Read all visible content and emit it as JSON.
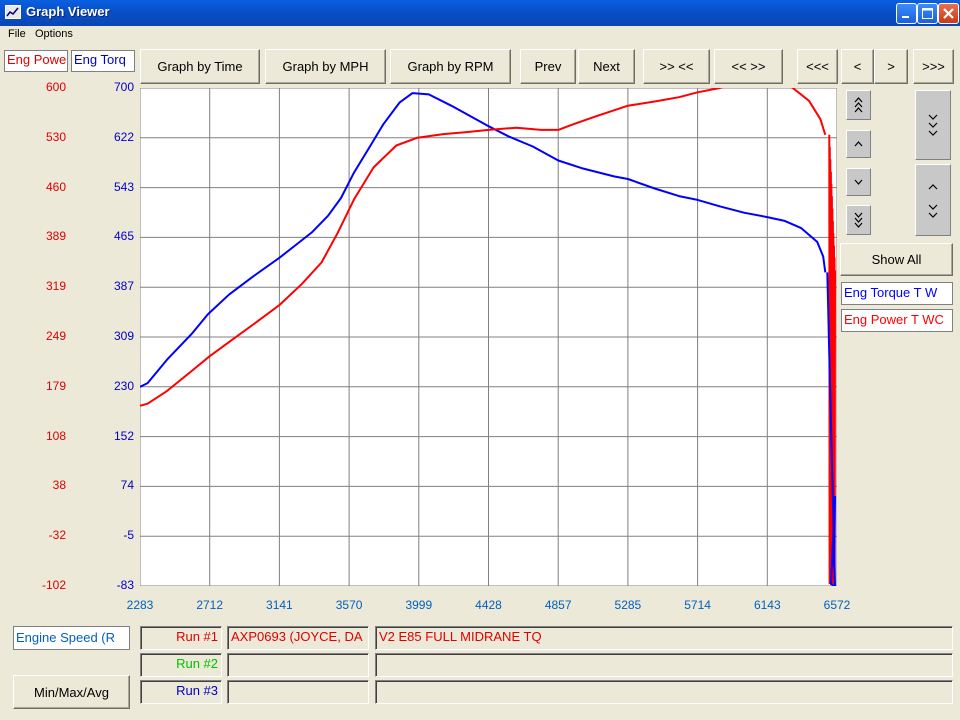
{
  "window": {
    "title": "Graph Viewer"
  },
  "menu": {
    "items": [
      "File",
      "Options"
    ]
  },
  "axis_titles": {
    "left_red": "Eng Powe",
    "left_blue": "Eng Torq",
    "bottom": "Engine Speed (R"
  },
  "toolbar": {
    "graph_by_time": "Graph by Time",
    "graph_by_mph": "Graph by MPH",
    "graph_by_rpm": "Graph by RPM",
    "prev": "Prev",
    "next": "Next",
    "zoom_in": ">> <<",
    "zoom_out": "<< >>",
    "scroll_far_left": "<<<",
    "scroll_left": "<",
    "scroll_right": ">",
    "scroll_far_right": ">>>"
  },
  "side": {
    "show_all": "Show All",
    "legend": [
      "Eng Torque T W",
      "Eng Power T WC"
    ]
  },
  "colors": {
    "power": "#ff0000",
    "torque": "#0000ff",
    "run1": "#e00000",
    "run2": "#00c000",
    "run3": "#0000c0"
  },
  "runs": [
    {
      "label": "Run #1",
      "file": "AXP0693 (JOYCE, DA",
      "desc": "V2 E85 FULL MIDRANE TQ"
    },
    {
      "label": "Run #2",
      "file": "",
      "desc": ""
    },
    {
      "label": "Run #3",
      "file": "",
      "desc": ""
    }
  ],
  "buttons": {
    "min_max_avg": "Min/Max/Avg"
  },
  "chart_data": {
    "type": "line",
    "xlabel": "Engine Speed (R",
    "xlim": [
      2283,
      6572
    ],
    "x_ticks": [
      "2283",
      "2712",
      "3141",
      "3570",
      "3999",
      "4428",
      "4857",
      "5285",
      "5714",
      "6143",
      "6572"
    ],
    "y_power_ticks": [
      "600",
      "530",
      "460",
      "389",
      "319",
      "249",
      "179",
      "108",
      "38",
      "-32",
      "-102"
    ],
    "y_torque_ticks": [
      "700",
      "622",
      "543",
      "465",
      "387",
      "309",
      "230",
      "152",
      "74",
      "-5",
      "-83"
    ],
    "y_power_lim": [
      -102,
      600
    ],
    "y_torque_lim": [
      -83,
      700
    ],
    "series": [
      {
        "name": "Eng Torque T W",
        "axis": "torque",
        "color": "#0000ff",
        "x": [
          2283,
          2330,
          2450,
          2600,
          2700,
          2830,
          2980,
          3141,
          3260,
          3340,
          3440,
          3520,
          3600,
          3700,
          3780,
          3880,
          3960,
          4060,
          4200,
          4300,
          4428,
          4550,
          4700,
          4857,
          5000,
          5200,
          5285,
          5450,
          5600,
          5714,
          5850,
          6000,
          6143,
          6250,
          6350,
          6450,
          6487,
          6500
        ],
        "y": [
          230,
          236,
          273,
          313,
          344,
          375,
          404,
          433,
          457,
          473,
          499,
          527,
          567,
          609,
          643,
          677,
          692,
          690,
          672,
          658,
          640,
          624,
          608,
          586,
          574,
          561,
          557,
          542,
          530,
          524,
          514,
          504,
          497,
          491,
          480,
          458,
          435,
          410
        ]
      },
      {
        "name": "Eng Power T WC",
        "axis": "power",
        "color": "#ff0000",
        "x": [
          2283,
          2330,
          2450,
          2600,
          2712,
          2850,
          3000,
          3141,
          3280,
          3400,
          3500,
          3600,
          3720,
          3860,
          3990,
          4150,
          4300,
          4428,
          4600,
          4750,
          4857,
          4950,
          5100,
          5285,
          5450,
          5600,
          5714,
          5850,
          6000,
          6143,
          6200,
          6300,
          6400,
          6470,
          6500
        ],
        "y": [
          152,
          155,
          173,
          201,
          222,
          245,
          270,
          294,
          324,
          354,
          396,
          443,
          488,
          519,
          530,
          535,
          538,
          541,
          544,
          541,
          541,
          549,
          561,
          575,
          581,
          587,
          594,
          600,
          608,
          613,
          611,
          600,
          582,
          556,
          534
        ]
      }
    ],
    "drop_band": {
      "x_range": [
        6500,
        6572
      ],
      "note": "red/blue oscillation down to axis bottom"
    }
  }
}
